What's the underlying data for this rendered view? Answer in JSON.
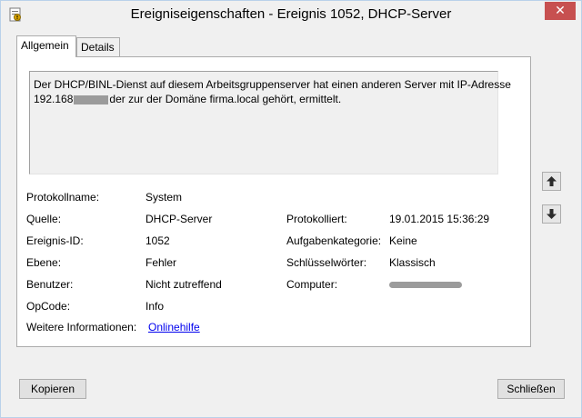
{
  "window": {
    "title": "Ereigniseigenschaften - Ereignis 1052, DHCP-Server",
    "close_glyph": "✕"
  },
  "tabs": [
    {
      "label": "Allgemein",
      "active": true
    },
    {
      "label": "Details",
      "active": false
    }
  ],
  "description": {
    "line1": "Der DHCP/BINL-Dienst auf diesem Arbeitsgruppenserver hat einen anderen Server mit IP-Adresse",
    "line2_prefix": "192.168",
    "line2_suffix": "der zur der Domäne firma.local gehört, ermittelt."
  },
  "fields": {
    "protokollname": {
      "label": "Protokollname:",
      "value": "System"
    },
    "quelle": {
      "label": "Quelle:",
      "value": "DHCP-Server"
    },
    "protokolliert": {
      "label": "Protokolliert:",
      "value": "19.01.2015 15:36:29"
    },
    "ereignis_id": {
      "label": "Ereignis-ID:",
      "value": "1052"
    },
    "aufgabenkategorie": {
      "label": "Aufgabenkategorie:",
      "value": "Keine"
    },
    "ebene": {
      "label": "Ebene:",
      "value": "Fehler"
    },
    "schluesselwoerter": {
      "label": "Schlüsselwörter:",
      "value": "Klassisch"
    },
    "benutzer": {
      "label": "Benutzer:",
      "value": "Nicht zutreffend"
    },
    "computer": {
      "label": "Computer:",
      "value": ""
    },
    "opcode": {
      "label": "OpCode:",
      "value": "Info"
    },
    "weitere": {
      "label": "Weitere Informationen:",
      "link": "Onlinehilfe"
    }
  },
  "icons": {
    "window_icon": "event-log-icon",
    "up": "arrow-up-icon",
    "down": "arrow-down-icon"
  },
  "buttons": {
    "copy": "Kopieren",
    "close": "Schließen"
  }
}
